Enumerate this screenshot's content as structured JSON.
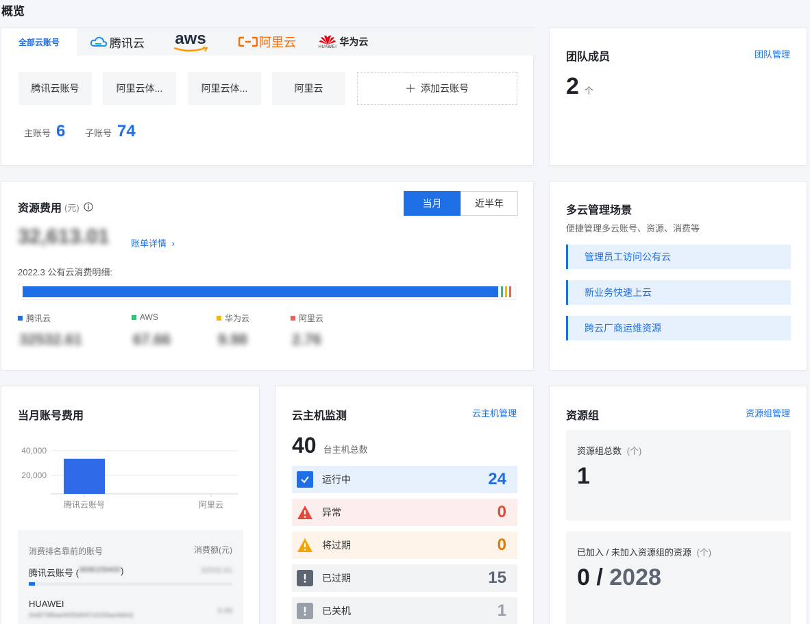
{
  "page": {
    "title": "概览"
  },
  "accounts": {
    "tabs": [
      {
        "label": "全部云账号"
      },
      {
        "label": "腾讯云"
      },
      {
        "label": "aws"
      },
      {
        "label": "阿里云"
      },
      {
        "label": "华为云",
        "sub": "HUAWEI"
      }
    ],
    "chips": [
      "腾讯云账号",
      "阿里云体...",
      "阿里云体...",
      "阿里云"
    ],
    "add_label": "添加云账号",
    "main_label": "主账号",
    "main_count": "6",
    "sub_label": "子账号",
    "sub_count": "74"
  },
  "team": {
    "title": "团队成员",
    "manage_link": "团队管理",
    "count": "2",
    "unit": "个"
  },
  "cost": {
    "title": "资源费用",
    "unit": "(元)",
    "toggle": [
      "当月",
      "近半年"
    ],
    "total_blurred": "32,613.01",
    "detail_link": "账单详情",
    "period_label": "2022.3 公有云消费明细:",
    "legend": [
      {
        "name": "腾讯云",
        "value": "32532.61",
        "color": "#1e6fe6"
      },
      {
        "name": "AWS",
        "value": "67.66",
        "color": "#3dbb7a"
      },
      {
        "name": "华为云",
        "value": "9.98",
        "color": "#f5b800"
      },
      {
        "name": "阿里云",
        "value": "2.76",
        "color": "#e5645a"
      }
    ]
  },
  "scenarios": {
    "title": "多云管理场景",
    "subtitle": "便捷管理多云账号、资源、消费等",
    "items": [
      "管理员工访问公有云",
      "新业务快速上云",
      "跨云厂商运维资源"
    ]
  },
  "monthly": {
    "title": "当月账号费用",
    "chart_data": {
      "type": "bar",
      "categories": [
        "腾讯云账号",
        "阿里云"
      ],
      "values": [
        32532.61,
        0
      ],
      "yticks": [
        "40,000",
        "20,000"
      ],
      "ylim": [
        0,
        50000
      ]
    },
    "toplist": {
      "header_left": "消费排名靠前的账号",
      "header_right": "消费额(元)",
      "rows": [
        {
          "name": "腾讯云账号 (",
          "id_blurred": "3696159400",
          "suffix": ")",
          "value_blurred": "32532.61",
          "fraction": 0.03
        },
        {
          "name": "HUAWEI",
          "id_blurred": "(hid5798bae6659d6f47c6159ae4bfe4)",
          "suffix": "",
          "value_blurred": "9.98",
          "fraction": 0.0
        }
      ]
    }
  },
  "hosts": {
    "title": "云主机监测",
    "manage_link": "云主机管理",
    "total": "40",
    "total_label": "台主机总数",
    "rows": [
      {
        "name": "运行中",
        "count": "24",
        "bg": "#e7f0fd",
        "color": "#1e6fe6",
        "icon": "check-icon"
      },
      {
        "name": "异常",
        "count": "0",
        "bg": "#fdeeee",
        "color": "#e5493a",
        "icon": "error-triangle-icon"
      },
      {
        "name": "将过期",
        "count": "0",
        "bg": "#fdf3e8",
        "color": "#e07b00",
        "icon": "warning-triangle-icon"
      },
      {
        "name": "已过期",
        "count": "15",
        "bg": "#f2f3f5",
        "color": "#5d6472",
        "icon": "expired-icon"
      },
      {
        "name": "已关机",
        "count": "1",
        "bg": "#f2f3f5",
        "color": "#9aa0aa",
        "icon": "shutdown-icon"
      }
    ]
  },
  "groups": {
    "title": "资源组",
    "manage_link": "资源组管理",
    "total_label": "资源组总数",
    "total_unit": "(个)",
    "total": "1",
    "joined_label": "已加入 / 未加入资源组的资源",
    "joined_unit": "(个)",
    "joined": "0 /",
    "not_joined": "2028"
  }
}
